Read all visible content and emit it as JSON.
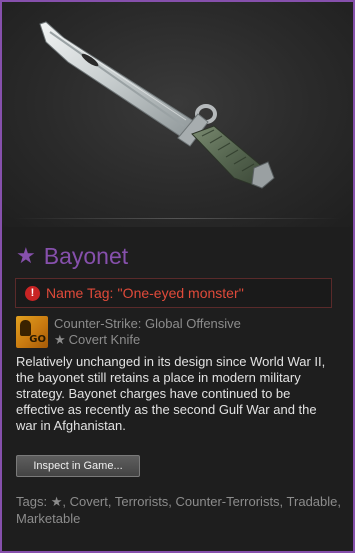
{
  "item": {
    "name": "Bayonet",
    "star": "★",
    "name_color": "#8650ac",
    "image_icon": "knife-image"
  },
  "name_tag": {
    "icon": "alert-icon",
    "icon_glyph": "!",
    "text": "Name Tag: ''One-eyed monster''",
    "color": "#e04a3a"
  },
  "game": {
    "icon": "csgo-icon",
    "icon_label": "GO",
    "name": "Counter-Strike: Global Offensive",
    "type_star": "★",
    "type": "Covert Knife"
  },
  "description": "Relatively unchanged in its design since World War II, the bayonet still retains a place in modern military strategy. Bayonet charges have continued to be effective as recently as the second Gulf War and the war in Afghanistan.",
  "inspect_button": {
    "label": "Inspect in Game..."
  },
  "tags": {
    "label": "Tags:",
    "star": "★",
    "text": ", Covert, Terrorists, Counter-Terrorists, Tradable, Marketable"
  }
}
